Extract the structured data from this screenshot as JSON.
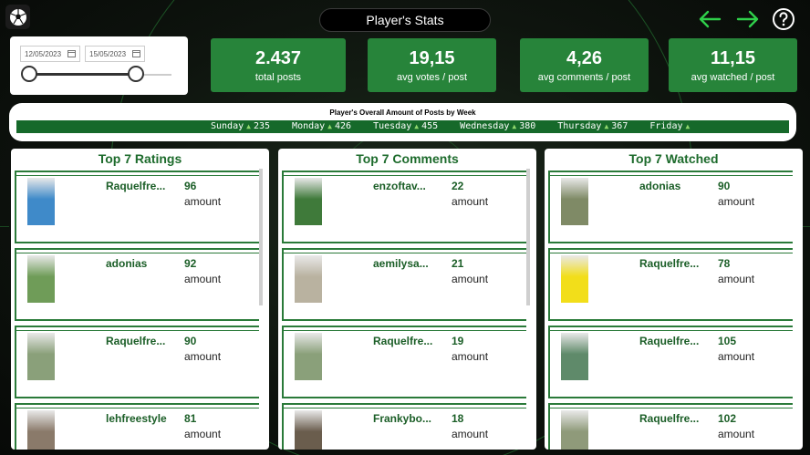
{
  "header": {
    "title": "Player's Stats"
  },
  "date_filter": {
    "start": "12/05/2023",
    "end": "15/05/2023"
  },
  "kpis": [
    {
      "value": "2.437",
      "label": "total posts"
    },
    {
      "value": "19,15",
      "label": "avg votes / post"
    },
    {
      "value": "4,26",
      "label": "avg comments / post"
    },
    {
      "value": "11,15",
      "label": "avg watched / post"
    }
  ],
  "weekly": {
    "title": "Player's Overall Amount of Posts by Week",
    "days": [
      {
        "day": "Sunday",
        "value": "235"
      },
      {
        "day": "Monday",
        "value": "426"
      },
      {
        "day": "Tuesday",
        "value": "455"
      },
      {
        "day": "Wednesday",
        "value": "380"
      },
      {
        "day": "Thursday",
        "value": "367"
      },
      {
        "day": "Friday",
        "value": ""
      }
    ]
  },
  "panels": [
    {
      "title": "Top 7 Ratings",
      "rows": [
        {
          "name": "Raquelfre...",
          "value": "96",
          "unit": "amount",
          "thumb": "#3f8ac9"
        },
        {
          "name": "adonias",
          "value": "92",
          "unit": "amount",
          "thumb": "#6f9c58"
        },
        {
          "name": "Raquelfre...",
          "value": "90",
          "unit": "amount",
          "thumb": "#8aa07a"
        },
        {
          "name": "lehfreestyle",
          "value": "81",
          "unit": "amount",
          "thumb": "#8a7a6a"
        }
      ]
    },
    {
      "title": "Top 7 Comments",
      "rows": [
        {
          "name": "enzoftav...",
          "value": "22",
          "unit": "amount",
          "thumb": "#3f7a3a"
        },
        {
          "name": "aemilysa...",
          "value": "21",
          "unit": "amount",
          "thumb": "#b9b2a0"
        },
        {
          "name": "Raquelfre...",
          "value": "19",
          "unit": "amount",
          "thumb": "#8aa07a"
        },
        {
          "name": "Frankybo...",
          "value": "18",
          "unit": "amount",
          "thumb": "#6a5d4d"
        }
      ]
    },
    {
      "title": "Top 7 Watched",
      "rows": [
        {
          "name": "adonias",
          "value": "90",
          "unit": "amount",
          "thumb": "#7f8a66"
        },
        {
          "name": "Raquelfre...",
          "value": "78",
          "unit": "amount",
          "thumb": "#f2de1a"
        },
        {
          "name": "Raquelfre...",
          "value": "105",
          "unit": "amount",
          "thumb": "#5f8a6a"
        },
        {
          "name": "Raquelfre...",
          "value": "102",
          "unit": "amount",
          "thumb": "#8f9a7a"
        }
      ]
    }
  ],
  "colors": {
    "accent": "#27843a",
    "nav_arrow": "#2fd04a",
    "panel_title": "#1d6b2c"
  }
}
